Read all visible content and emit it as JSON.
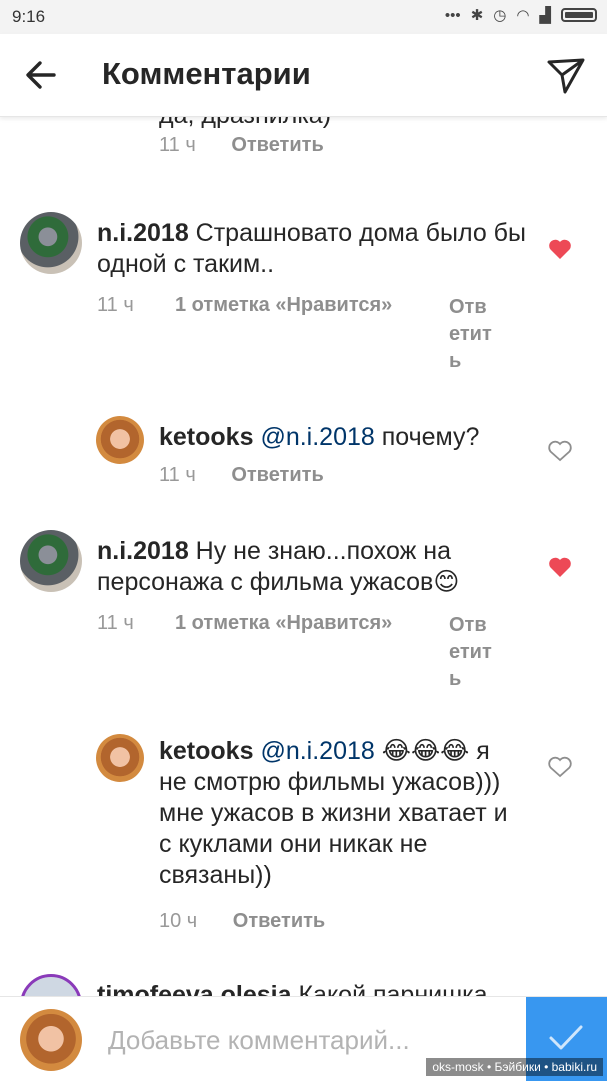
{
  "status": {
    "time": "9:16"
  },
  "header": {
    "title": "Комментарии"
  },
  "top_partial": {
    "text": "да, дразнилка)",
    "time": "11 ч",
    "reply": "Ответить"
  },
  "comments": [
    {
      "username": "n.i.2018",
      "mention": "",
      "text": " Страшновато дома было бы одной с таким..",
      "time": "11 ч",
      "likes": "1 отметка «Нравится»",
      "reply": "Ответить",
      "liked": true
    },
    {
      "username": "ketooks",
      "mention": "@n.i.2018",
      "text": " почему?",
      "time": "11 ч",
      "likes": "",
      "reply": "Ответить",
      "liked": false
    },
    {
      "username": "n.i.2018",
      "mention": "",
      "text": " Ну не знаю...похож на персонажа с фильма ужасов😊",
      "time": "11 ч",
      "likes": "1 отметка «Нравится»",
      "reply": "Ответить",
      "liked": true
    },
    {
      "username": "ketooks",
      "mention": "@n.i.2018",
      "text": " 😂😂😂 я не смотрю фильмы ужасов))) мне ужасов в жизни хватает и с куклами они никак не связаны))",
      "time": "10 ч",
      "likes": "",
      "reply": "Ответить",
      "liked": false
    },
    {
      "username": "timofeeva.olesia",
      "mention": "",
      "text": " Какой парнишка",
      "time": "",
      "likes": "",
      "reply": "",
      "liked": false
    }
  ],
  "composer": {
    "placeholder": "Добавьте комментарий..."
  },
  "watermark": "oks-mosk • Бэйбики • babiki.ru",
  "colors": {
    "accent": "#3897f0",
    "heart": "#ed4956",
    "mention": "#003569"
  },
  "icons": [
    "back-arrow-icon",
    "send-icon",
    "heart-icon",
    "check-icon"
  ]
}
